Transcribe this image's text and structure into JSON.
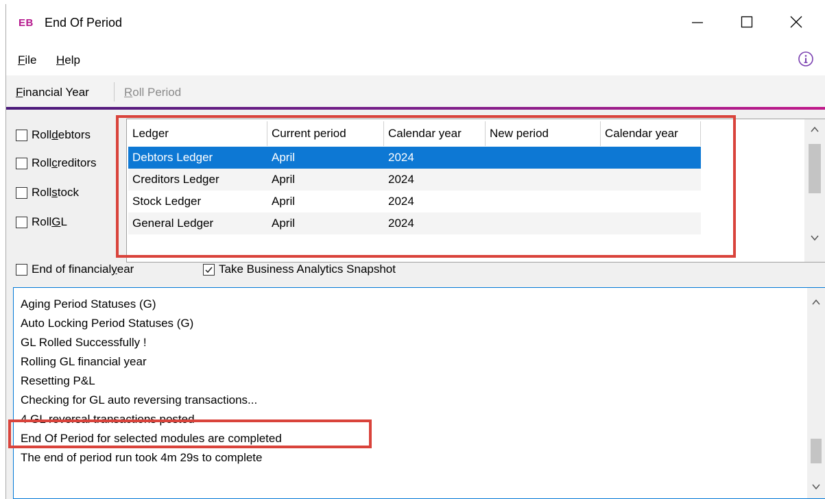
{
  "window": {
    "app_badge": "EB",
    "title": "End Of Period"
  },
  "menu": {
    "file_prefix": "F",
    "file_rest": "ile",
    "help_prefix": "H",
    "help_rest": "elp"
  },
  "toolbar": {
    "financial_year_prefix": "F",
    "financial_year_rest": "inancial Year",
    "roll_period_prefix": "R",
    "roll_period_rest": "oll Period"
  },
  "options": {
    "roll_debtors": {
      "pre": "Roll ",
      "key": "d",
      "post": "ebtors",
      "checked": false
    },
    "roll_creditors": {
      "pre": "Roll ",
      "key": "c",
      "post": "reditors",
      "checked": false
    },
    "roll_stock": {
      "pre": "Roll ",
      "key": "s",
      "post": "tock",
      "checked": false
    },
    "roll_gl": {
      "pre": "Roll ",
      "key": "G",
      "post": "L",
      "checked": false
    },
    "end_of_financial_year": {
      "pre": "End of financial ",
      "key": "y",
      "post": "ear",
      "checked": false
    },
    "take_snapshot": {
      "label": "Take Business Analytics Snapshot",
      "checked": true
    }
  },
  "ledger_grid": {
    "columns": [
      "Ledger",
      "Current period",
      "Calendar year",
      "New period",
      "Calendar year"
    ],
    "rows": [
      {
        "ledger": "Debtors Ledger",
        "current_period": "April",
        "calendar_year": "2024",
        "new_period": "",
        "new_calendar_year": "",
        "selected": true
      },
      {
        "ledger": "Creditors Ledger",
        "current_period": "April",
        "calendar_year": "2024",
        "new_period": "",
        "new_calendar_year": "",
        "selected": false
      },
      {
        "ledger": "Stock Ledger",
        "current_period": "April",
        "calendar_year": "2024",
        "new_period": "",
        "new_calendar_year": "",
        "selected": false
      },
      {
        "ledger": "General Ledger",
        "current_period": "April",
        "calendar_year": "2024",
        "new_period": "",
        "new_calendar_year": "",
        "selected": false
      }
    ]
  },
  "log": {
    "lines": [
      "Aging Period Statuses (G)",
      "Auto Locking Period Statuses (G)",
      "GL Rolled Successfully !",
      "Rolling GL financial year",
      "Resetting P&L",
      "Checking for GL auto reversing transactions...",
      "4 GL reversal transactions posted",
      "End Of Period for selected modules are completed",
      "The end of period run took 4m 29s to complete"
    ]
  },
  "colors": {
    "accent_gradient_start": "#4a1a7a",
    "accent_gradient_end": "#c0198a",
    "selection": "#0d78d4",
    "highlight_annotation": "#d9433b",
    "app_badge": "#b5198d"
  },
  "icons": [
    "minimize-icon",
    "maximize-icon",
    "close-icon",
    "info-icon",
    "checkmark-icon",
    "chevron-up-icon",
    "chevron-down-icon"
  ]
}
